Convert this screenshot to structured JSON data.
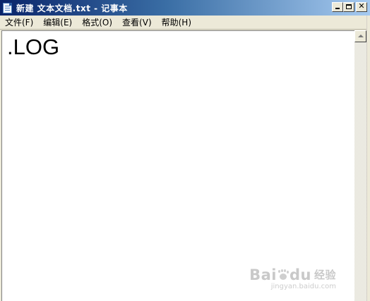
{
  "window": {
    "title": "新建 文本文档.txt - 记事本"
  },
  "menu": {
    "items": [
      "文件(F)",
      "编辑(E)",
      "格式(O)",
      "查看(V)",
      "帮助(H)"
    ]
  },
  "editor": {
    "content": ".LOG"
  },
  "watermark": {
    "brand_a": "Bai",
    "brand_b": "du",
    "brand_cn": "经验",
    "url": "jingyan.baidu.com"
  },
  "icons": {
    "app": "notepad-icon",
    "minimize": "minimize-icon",
    "maximize": "maximize-icon",
    "close": "close-icon",
    "scroll_up": "arrow-up-icon"
  },
  "colors": {
    "title_start": "#0a246a",
    "title_end": "#a6caf0",
    "chrome": "#ece9d8",
    "editor_bg": "#ffffff"
  }
}
